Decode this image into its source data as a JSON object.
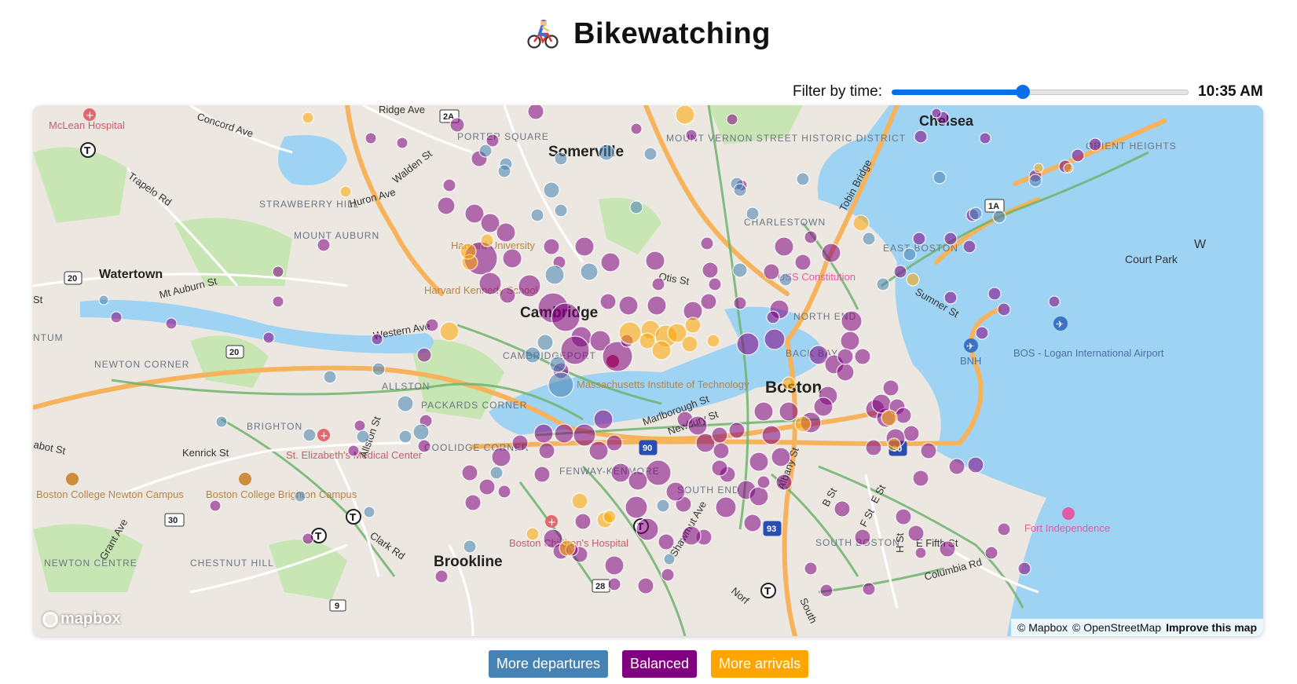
{
  "header": {
    "title": "Bikewatching",
    "icon": "bicyclist-icon"
  },
  "filter": {
    "label": "Filter by time:",
    "time": "10:35 AM",
    "value": 635,
    "min": -1,
    "max": 1440
  },
  "map": {
    "attribution": {
      "mapbox": "© Mapbox",
      "osm": "© OpenStreetMap",
      "improve": "Improve this map"
    },
    "logo": "mapbox",
    "labels": {
      "somerville": "Somerville",
      "cambridge": "Cambridge",
      "boston": "Boston",
      "watertown": "Watertown",
      "brookline": "Brookline",
      "chelsea": "Chelsea",
      "charlestown": "CHARLESTOWN",
      "allston": "ALLSTON",
      "brighton": "BRIGHTON",
      "newton_corner": "NEWTON CORNER",
      "newton_centre": "NEWTON CENTRE",
      "chestnut_hill": "CHESTNUT HILL",
      "south_boston": "SOUTH BOSTON",
      "east_boston": "EAST BOSTON",
      "north_end": "NORTH END",
      "south_end": "SOUTH END",
      "fenway": "FENWAY-KENMORE",
      "back_bay": "BACK BAY",
      "cambridgeport": "CAMBRIDGEPORT",
      "coolidge": "COOLIDGE CORNER",
      "packards": "PACKARDS CORNER",
      "porter": "PORTER SQUARE",
      "strawberry": "STRAWBERRY HILL",
      "mount_auburn": "MOUNT AUBURN",
      "mount_vernon": "MOUNT VERNON STREET HISTORIC DISTRICT",
      "orient": "ORIENT HEIGHTS",
      "court_park": "Court Park",
      "logan": "BOS - Logan International Airport",
      "bnh": "BNH",
      "mclean": "McLean Hospital",
      "harvard": "Harvard University",
      "kennedy": "Harvard Kennedy School",
      "mit": "Massachusetts Institute of Technology",
      "uss": "USS Constitution",
      "st_eliz": "St. Elizabeth's Medical Center",
      "bc_newton": "Boston College Newton Campus",
      "bc_brighton": "Boston College Brighton Campus",
      "childrens": "Boston Children's Hospital",
      "fort": "Fort Independence",
      "concord_ave": "Concord Ave",
      "ridge_ave": "Ridge Ave",
      "trapelo": "Trapelo Rd",
      "huron": "Huron Ave",
      "walden": "Walden St",
      "mt_auburn_st": "Mt Auburn St",
      "western": "Western Ave",
      "kenrick": "Kenrick St",
      "allston_st": "Allston St",
      "clark": "Clark Rd",
      "grant": "Grant Ave",
      "marlborough": "Marlborough St",
      "newbury": "Newbury St",
      "albany": "Albany St",
      "shawmut": "Shawmut Ave",
      "otis": "Otis St",
      "sumner": "Sumner St",
      "tobin": "Tobin Bridge",
      "b_st": "B St",
      "e_st": "E St",
      "f_st": "F St",
      "e_fifth": "E Fifth St",
      "columbia": "Columbia Rd",
      "abot": "abot St",
      "st_left": "St",
      "ntum": "NTUM",
      "w_right": "W",
      "south": "South",
      "norf": "Norf",
      "h_st": "H St",
      "shield_2a": "2A",
      "shield_1a": "1A",
      "shield_20": "20",
      "shield_20b": "20",
      "shield_30": "30",
      "shield_28": "28",
      "shield_9": "9",
      "shield_90": "90",
      "shield_90b": "90",
      "shield_93": "93"
    }
  },
  "legend": {
    "departures": {
      "label": "More departures",
      "color": "#4682b4"
    },
    "balanced": {
      "label": "Balanced",
      "color": "#800080"
    },
    "arrivals": {
      "label": "More arrivals",
      "color": "#ffa500"
    }
  },
  "colors": {
    "water": "#9fd3f4",
    "land": "#ece8e1",
    "park": "#c8e6b4",
    "highway": "#f7b25c",
    "bike_lane": "#6fb36f",
    "road": "#ffffff",
    "marker_balanced": "#800080",
    "marker_departures": "#4682b4",
    "marker_arrivals": "#ffa500",
    "accent": "#0b6fe6"
  }
}
